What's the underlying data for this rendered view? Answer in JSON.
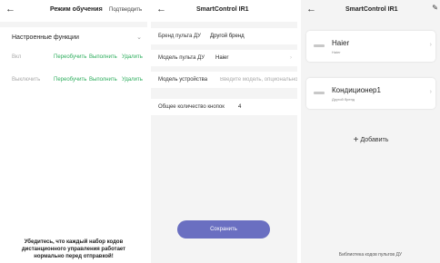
{
  "screen1": {
    "title": "Режим обучения",
    "confirm": "Подтвердить",
    "section": "Настроенные функции",
    "rows": [
      {
        "label": "Вкл",
        "actions": [
          "Переобучить",
          "Выполнить",
          "Удалить"
        ]
      },
      {
        "label": "Выключить",
        "actions": [
          "Переобучить",
          "Выполнить",
          "Удалить"
        ]
      }
    ],
    "notice": [
      "Убедитесь, что каждый набор кодов",
      "дистанционного управления работает",
      "нормально перед отправкой!"
    ]
  },
  "screen2": {
    "title": "SmartControl IR1",
    "fields": [
      {
        "label": "Бренд пульта ДУ",
        "value": "Другой бренд"
      },
      {
        "label": "Модель пульта ДУ",
        "value": "Haier"
      },
      {
        "label": "Модель устройства",
        "placeholder": "Введите модель, опционально"
      },
      {
        "label": "Общее количество кнопок",
        "value": "4"
      }
    ],
    "save": "Сохранить"
  },
  "screen3": {
    "title": "SmartControl IR1",
    "remotes": [
      {
        "name": "Haier",
        "subtitle": "Haier"
      },
      {
        "name": "Кондиционер1",
        "subtitle": "Другой бренд"
      }
    ],
    "add": "Добавить",
    "footer": "Библиотека кодов пультов ДУ"
  },
  "colors": {
    "accent_green": "#2fae5e",
    "save_button": "#6a6fc1"
  },
  "icons": {
    "back": "arrow-left-icon",
    "chevron_right": "chevron-right-icon",
    "chevron_down": "chevron-down-icon",
    "edit": "pencil-icon",
    "remote": "remote-icon",
    "plus": "plus-icon"
  }
}
